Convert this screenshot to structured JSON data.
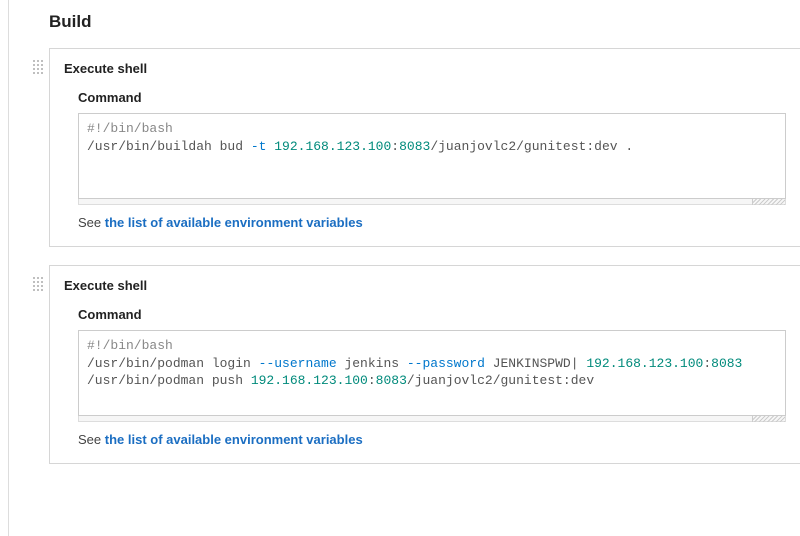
{
  "section_title": "Build",
  "steps": [
    {
      "title": "Execute shell",
      "command_label": "Command",
      "command_lines": [
        {
          "tokens": [
            {
              "t": "#!/bin/bash",
              "c": "comment"
            }
          ]
        },
        {
          "tokens": [
            {
              "t": "/usr/bin/buildah bud "
            },
            {
              "t": "-t",
              "c": "flag"
            },
            {
              "t": " "
            },
            {
              "t": "192.168.123.100",
              "c": "number"
            },
            {
              "t": ":"
            },
            {
              "t": "8083",
              "c": "number"
            },
            {
              "t": "/juanjovlc2/gunitest:dev ."
            }
          ]
        }
      ],
      "help_prefix": "See ",
      "help_link": "the list of available environment variables"
    },
    {
      "title": "Execute shell",
      "command_label": "Command",
      "command_lines": [
        {
          "tokens": [
            {
              "t": "#!/bin/bash",
              "c": "comment"
            }
          ]
        },
        {
          "tokens": [
            {
              "t": "/usr/bin/podman login "
            },
            {
              "t": "--username",
              "c": "flag"
            },
            {
              "t": " jenkins "
            },
            {
              "t": "--password",
              "c": "flag"
            },
            {
              "t": " JENKINSPWD| "
            },
            {
              "t": "192.168.123.100",
              "c": "number"
            },
            {
              "t": ":"
            },
            {
              "t": "8083",
              "c": "number"
            }
          ]
        },
        {
          "tokens": [
            {
              "t": "/usr/bin/podman push "
            },
            {
              "t": "192.168.123.100",
              "c": "number"
            },
            {
              "t": ":"
            },
            {
              "t": "8083",
              "c": "number"
            },
            {
              "t": "/juanjovlc2/gunitest:dev"
            }
          ]
        }
      ],
      "help_prefix": "See ",
      "help_link": "the list of available environment variables"
    }
  ]
}
